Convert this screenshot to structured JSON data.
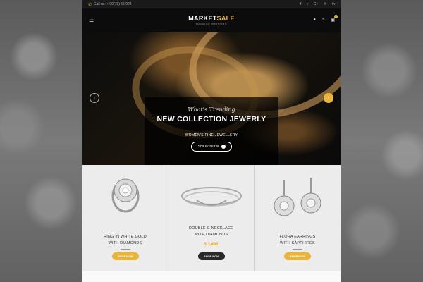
{
  "topbar": {
    "phone_label": "Call us: + 00(78) 55 922",
    "socials": [
      "f",
      "t",
      "G+",
      "℗",
      "in"
    ]
  },
  "header": {
    "logo_main": "MARKET",
    "logo_accent": "SALE",
    "logo_sub": "MAKATER SHOPPING",
    "cart_count": "0"
  },
  "hero": {
    "script": "What's Trending",
    "title": "NEW COLLECTION JEWERLY",
    "subtitle": "WOMEN'S FINE JEWELLERY",
    "button": "SHOP NOW",
    "prev": "‹",
    "next": "›"
  },
  "products": [
    {
      "name_line1": "RING IN WHITE GOLD",
      "name_line2": "WITH DIAMONDS",
      "price": "",
      "button": "SHOP NOW",
      "button_color": "#e8b53c"
    },
    {
      "name_line1": "DOUBLE G NECKLACE",
      "name_line2": "WITH DIAMONDS",
      "price": "$ 3,480",
      "button": "SHOP NOW",
      "button_color": "#2a2a2a"
    },
    {
      "name_line1": "FLORA EARRINGS",
      "name_line2": "WITH SAPPHIRES",
      "price": "",
      "button": "SHOP NOW",
      "button_color": "#e8b53c"
    }
  ],
  "colors": {
    "accent": "#e8b53c",
    "dark": "#0c0c0c"
  }
}
